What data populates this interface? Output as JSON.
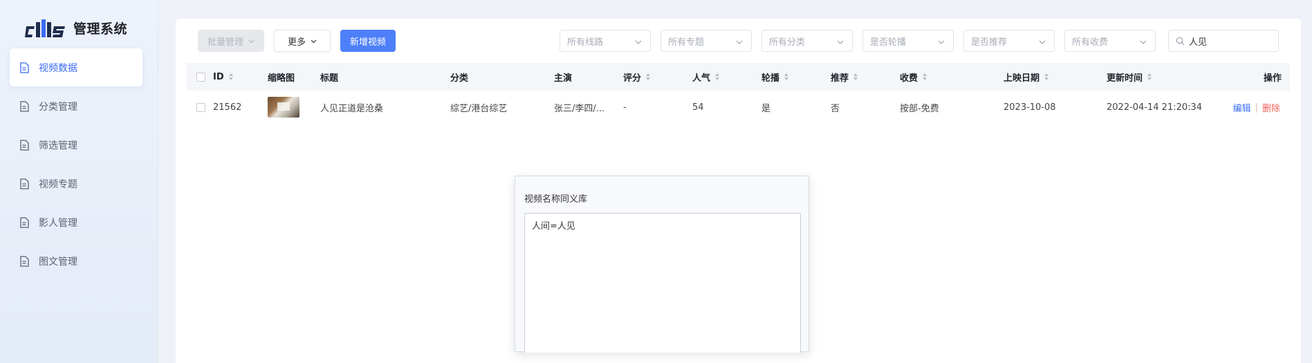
{
  "app": {
    "logo_text": "cms",
    "title": "管理系统"
  },
  "sidebar": {
    "items": [
      {
        "label": "视频数据",
        "icon": "document-icon",
        "active": true
      },
      {
        "label": "分类管理",
        "icon": "document-icon",
        "active": false
      },
      {
        "label": "筛选管理",
        "icon": "document-icon",
        "active": false
      },
      {
        "label": "视频专题",
        "icon": "document-icon",
        "active": false
      },
      {
        "label": "影人管理",
        "icon": "document-icon",
        "active": false
      },
      {
        "label": "图文管理",
        "icon": "document-icon",
        "active": false
      }
    ]
  },
  "toolbar": {
    "batch_label": "批量管理",
    "more_label": "更多",
    "add_label": "新增视频",
    "filters": [
      "所有线路",
      "所有专题",
      "所有分类",
      "是否轮播",
      "是否推荐",
      "所有收费"
    ],
    "search_value": "人见",
    "search_placeholder": "搜索"
  },
  "table": {
    "headers": {
      "id": "ID",
      "thumb": "缩略图",
      "title": "标题",
      "category": "分类",
      "actor": "主演",
      "rating": "评分",
      "popularity": "人气",
      "carousel": "轮播",
      "recommend": "推荐",
      "charge": "收费",
      "release": "上映日期",
      "updated": "更新时间",
      "actions": "操作"
    },
    "rows": [
      {
        "id": "21562",
        "title": "人见正道是沧桑",
        "category": "综艺/港台综艺",
        "actor": "张三/李四/...",
        "rating": "-",
        "popularity": "54",
        "carousel": "是",
        "recommend": "否",
        "charge": "按部-免费",
        "release": "2023-10-08",
        "updated": "2022-04-14 21:20:34",
        "edit": "编辑",
        "delete": "删除"
      }
    ]
  },
  "dialog": {
    "title": "视频名称同义库",
    "content": "人间=人见"
  },
  "colors": {
    "accent": "#4d7ff9",
    "danger": "#f0605a",
    "sidebar_bg": "#eef2fb"
  }
}
